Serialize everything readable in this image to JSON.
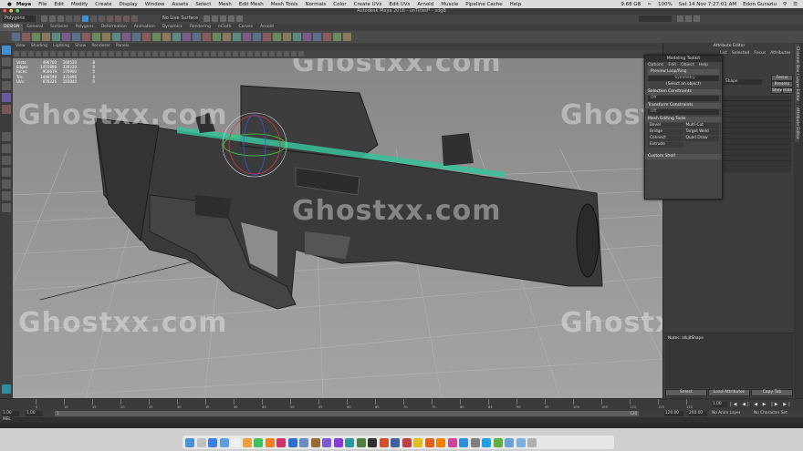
{
  "macos": {
    "app": "Maya",
    "menus": [
      "File",
      "Edit",
      "Modify",
      "Create",
      "Display",
      "Window",
      "Assets",
      "Select",
      "Mesh",
      "Edit Mesh",
      "Mesh Tools",
      "Normals",
      "Color",
      "Create UVs",
      "Edit UVs",
      "Arnold",
      "Muscle",
      "Pipeline Cache",
      "Help"
    ],
    "battery": "100%",
    "datetime": "Sat 14 Nov 7:27:01 AM",
    "user": "Edon Guraziu",
    "disk": "9.68 GB"
  },
  "window_title": "Autodesk Maya 2016 - unTitled* - sdgB",
  "status_line": {
    "mode": "Polygons",
    "live_surface": "No Live Surface"
  },
  "shelf_tabs": [
    "DESIGN",
    "General",
    "Surfaces",
    "Polygons",
    "Deformation",
    "Animation",
    "Dynamics",
    "Rendering",
    "nCloth",
    "Curves",
    "Arnold"
  ],
  "active_shelf_tab": "DESIGN",
  "panel_menu": [
    "View",
    "Shading",
    "Lighting",
    "Show",
    "Renderer",
    "Panels"
  ],
  "hud": {
    "rows": [
      {
        "label": "Verts:",
        "a": "496700",
        "b": "160530",
        "c": "8"
      },
      {
        "label": "Edges:",
        "a": "1455898",
        "b": "339330",
        "c": "0"
      },
      {
        "label": "Faces:",
        "a": "900619",
        "b": "170900",
        "c": "0"
      },
      {
        "label": "Tris:",
        "a": "1448598",
        "b": "335896",
        "c": "0"
      },
      {
        "label": "UVs:",
        "a": "878326",
        "b": "183840",
        "c": "0"
      }
    ]
  },
  "watermark": "Ghostxx.com",
  "modeling_toolkit": {
    "title": "Modeling Toolkit",
    "menu": [
      "Options",
      "Edit",
      "Object",
      "Help"
    ],
    "preview_label": "Preview Loop/Ring",
    "symmetry_label": "Symmetry",
    "select_object": "(Select an object)",
    "selection_constraints": "Selection Constraints",
    "off_1": "Off",
    "transform_constraints": "Transform Constraints",
    "off_2": "Off",
    "mesh_editing_tools": "Mesh Editing Tools",
    "tools": [
      "Bevel",
      "Multi-Cut",
      "Bridge",
      "Target Weld",
      "Connect",
      "Quad Draw",
      "Extrude"
    ],
    "custom_shelf": "Custom Shelf"
  },
  "attribute_editor": {
    "title": "Attribute Editor",
    "menu": [
      "List",
      "Selected",
      "Focus",
      "Attributes",
      "Show",
      "Help"
    ],
    "shape_field": "Shape",
    "focus_button": "Focus",
    "presets_button": "Presets",
    "show_button": "Show",
    "hide_button": "Hide",
    "notes_label": "Notes: alkj8Shape",
    "buttons": [
      "Select",
      "Load Attributes",
      "Copy Tab"
    ]
  },
  "side_tabs": [
    "Channel Box / Layer Editor",
    "Attribute Editor"
  ],
  "time": {
    "ticks": [
      "5",
      "10",
      "15",
      "20",
      "25",
      "30",
      "35",
      "40",
      "45",
      "50",
      "55",
      "60",
      "65",
      "70",
      "75",
      "80",
      "85",
      "90",
      "95",
      "100",
      "105",
      "110",
      "115",
      "120"
    ],
    "current": "1.00",
    "start": "1.00",
    "range_start": "1.00",
    "range_fields": [
      "1",
      "120"
    ],
    "end": "120.00",
    "end2": "200.00",
    "anim_layer": "No Anim Layer",
    "char_set": "No Character Set"
  },
  "command": {
    "lang": "MEL"
  },
  "colors": {
    "accent": "#3f8fd3",
    "shelf_active": "#5a5a5a",
    "viewport_top": "#868686",
    "viewport_bottom": "#a4a4a4"
  },
  "dock_icons": [
    "finder-icon",
    "launchpad-icon",
    "safari-icon",
    "mail-icon",
    "calendar-icon",
    "photos-icon",
    "messages-icon",
    "illustrator-icon",
    "indesign-icon",
    "photoshop-icon",
    "lightroom-icon",
    "bridge-icon",
    "after-effects-icon",
    "premiere-icon",
    "maya-icon",
    "mudbox-icon",
    "zbrush-icon",
    "keyshot-icon",
    "marvelous-icon",
    "substance-icon",
    "chrome-icon",
    "firefox-icon",
    "vlc-icon",
    "itunes-icon",
    "appstore-icon",
    "preferences-icon",
    "skype-icon",
    "utorrent-icon",
    "folder-icon",
    "downloads-icon",
    "trash-icon"
  ]
}
